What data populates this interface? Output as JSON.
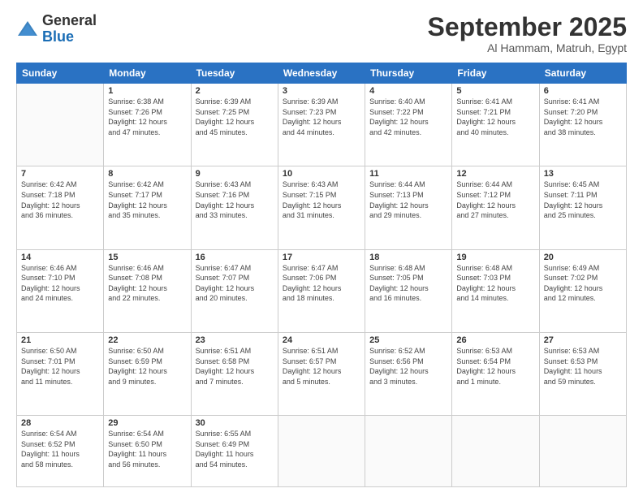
{
  "logo": {
    "general": "General",
    "blue": "Blue"
  },
  "title": "September 2025",
  "location": "Al Hammam, Matruh, Egypt",
  "days_header": [
    "Sunday",
    "Monday",
    "Tuesday",
    "Wednesday",
    "Thursday",
    "Friday",
    "Saturday"
  ],
  "weeks": [
    [
      {
        "num": "",
        "info": ""
      },
      {
        "num": "1",
        "info": "Sunrise: 6:38 AM\nSunset: 7:26 PM\nDaylight: 12 hours\nand 47 minutes."
      },
      {
        "num": "2",
        "info": "Sunrise: 6:39 AM\nSunset: 7:25 PM\nDaylight: 12 hours\nand 45 minutes."
      },
      {
        "num": "3",
        "info": "Sunrise: 6:39 AM\nSunset: 7:23 PM\nDaylight: 12 hours\nand 44 minutes."
      },
      {
        "num": "4",
        "info": "Sunrise: 6:40 AM\nSunset: 7:22 PM\nDaylight: 12 hours\nand 42 minutes."
      },
      {
        "num": "5",
        "info": "Sunrise: 6:41 AM\nSunset: 7:21 PM\nDaylight: 12 hours\nand 40 minutes."
      },
      {
        "num": "6",
        "info": "Sunrise: 6:41 AM\nSunset: 7:20 PM\nDaylight: 12 hours\nand 38 minutes."
      }
    ],
    [
      {
        "num": "7",
        "info": "Sunrise: 6:42 AM\nSunset: 7:18 PM\nDaylight: 12 hours\nand 36 minutes."
      },
      {
        "num": "8",
        "info": "Sunrise: 6:42 AM\nSunset: 7:17 PM\nDaylight: 12 hours\nand 35 minutes."
      },
      {
        "num": "9",
        "info": "Sunrise: 6:43 AM\nSunset: 7:16 PM\nDaylight: 12 hours\nand 33 minutes."
      },
      {
        "num": "10",
        "info": "Sunrise: 6:43 AM\nSunset: 7:15 PM\nDaylight: 12 hours\nand 31 minutes."
      },
      {
        "num": "11",
        "info": "Sunrise: 6:44 AM\nSunset: 7:13 PM\nDaylight: 12 hours\nand 29 minutes."
      },
      {
        "num": "12",
        "info": "Sunrise: 6:44 AM\nSunset: 7:12 PM\nDaylight: 12 hours\nand 27 minutes."
      },
      {
        "num": "13",
        "info": "Sunrise: 6:45 AM\nSunset: 7:11 PM\nDaylight: 12 hours\nand 25 minutes."
      }
    ],
    [
      {
        "num": "14",
        "info": "Sunrise: 6:46 AM\nSunset: 7:10 PM\nDaylight: 12 hours\nand 24 minutes."
      },
      {
        "num": "15",
        "info": "Sunrise: 6:46 AM\nSunset: 7:08 PM\nDaylight: 12 hours\nand 22 minutes."
      },
      {
        "num": "16",
        "info": "Sunrise: 6:47 AM\nSunset: 7:07 PM\nDaylight: 12 hours\nand 20 minutes."
      },
      {
        "num": "17",
        "info": "Sunrise: 6:47 AM\nSunset: 7:06 PM\nDaylight: 12 hours\nand 18 minutes."
      },
      {
        "num": "18",
        "info": "Sunrise: 6:48 AM\nSunset: 7:05 PM\nDaylight: 12 hours\nand 16 minutes."
      },
      {
        "num": "19",
        "info": "Sunrise: 6:48 AM\nSunset: 7:03 PM\nDaylight: 12 hours\nand 14 minutes."
      },
      {
        "num": "20",
        "info": "Sunrise: 6:49 AM\nSunset: 7:02 PM\nDaylight: 12 hours\nand 12 minutes."
      }
    ],
    [
      {
        "num": "21",
        "info": "Sunrise: 6:50 AM\nSunset: 7:01 PM\nDaylight: 12 hours\nand 11 minutes."
      },
      {
        "num": "22",
        "info": "Sunrise: 6:50 AM\nSunset: 6:59 PM\nDaylight: 12 hours\nand 9 minutes."
      },
      {
        "num": "23",
        "info": "Sunrise: 6:51 AM\nSunset: 6:58 PM\nDaylight: 12 hours\nand 7 minutes."
      },
      {
        "num": "24",
        "info": "Sunrise: 6:51 AM\nSunset: 6:57 PM\nDaylight: 12 hours\nand 5 minutes."
      },
      {
        "num": "25",
        "info": "Sunrise: 6:52 AM\nSunset: 6:56 PM\nDaylight: 12 hours\nand 3 minutes."
      },
      {
        "num": "26",
        "info": "Sunrise: 6:53 AM\nSunset: 6:54 PM\nDaylight: 12 hours\nand 1 minute."
      },
      {
        "num": "27",
        "info": "Sunrise: 6:53 AM\nSunset: 6:53 PM\nDaylight: 11 hours\nand 59 minutes."
      }
    ],
    [
      {
        "num": "28",
        "info": "Sunrise: 6:54 AM\nSunset: 6:52 PM\nDaylight: 11 hours\nand 58 minutes."
      },
      {
        "num": "29",
        "info": "Sunrise: 6:54 AM\nSunset: 6:50 PM\nDaylight: 11 hours\nand 56 minutes."
      },
      {
        "num": "30",
        "info": "Sunrise: 6:55 AM\nSunset: 6:49 PM\nDaylight: 11 hours\nand 54 minutes."
      },
      {
        "num": "",
        "info": ""
      },
      {
        "num": "",
        "info": ""
      },
      {
        "num": "",
        "info": ""
      },
      {
        "num": "",
        "info": ""
      }
    ]
  ]
}
